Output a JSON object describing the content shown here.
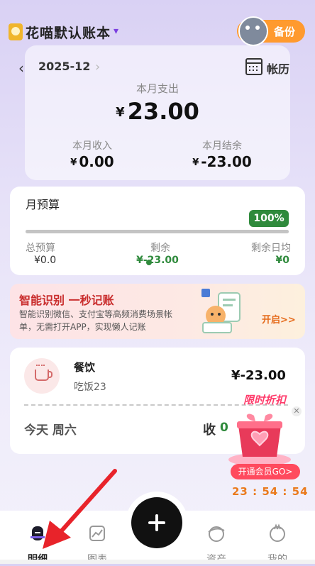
{
  "header": {
    "book_title": "花喵默认账本",
    "backup_label": "备份"
  },
  "summary": {
    "month": "2025-12",
    "calendar_label": "帐历",
    "expense_title": "本月支出",
    "expense_value": "23.00",
    "income_title": "本月收入",
    "income_value": "0.00",
    "balance_title": "本月结余",
    "balance_value": "-23.00",
    "currency": "¥"
  },
  "budget": {
    "title": "月预算",
    "badge": "100%",
    "fill_percent": 100,
    "total_title": "总预算",
    "total_value": "¥0.0",
    "remain_title": "剩余",
    "remain_value": "¥-23.00",
    "daily_title": "剩余日均",
    "daily_value": "¥0"
  },
  "promo": {
    "title": "智能识别 一秒记账",
    "desc": "智能识别微信、支付宝等高频消费场景帐单，无需打开APP，实现懒人记账",
    "open_label": "开启>>"
  },
  "records": {
    "category": "餐饮",
    "note": "吃饭23",
    "amount": "¥-23.00",
    "day_label": "今天 周六",
    "income_label": "收",
    "income_value": "0"
  },
  "float_promo": {
    "title": "限时折扣",
    "button": "开通会员GO>",
    "timer": "23 : 54 : 54"
  },
  "nav": {
    "items": [
      {
        "label": "明细",
        "icon": "detail-icon"
      },
      {
        "label": "图表",
        "icon": "chart-icon"
      },
      {
        "label": "资产",
        "icon": "assets-icon"
      },
      {
        "label": "我的",
        "icon": "profile-icon"
      }
    ]
  },
  "colors": {
    "accent_green": "#2f8a3c",
    "backup_orange": "#ff9a2e",
    "promo_red": "#c92d2d"
  }
}
